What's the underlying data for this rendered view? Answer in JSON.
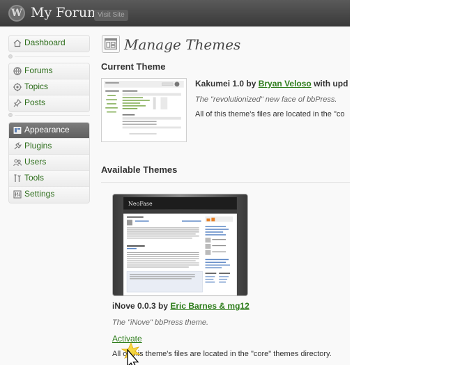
{
  "header": {
    "site_title": "My Forum",
    "visit_site_label": "Visit Site",
    "logo_letter": "W"
  },
  "sidebar": {
    "groups": [
      {
        "items": [
          {
            "label": "Dashboard",
            "icon": "home-icon"
          }
        ]
      },
      {
        "items": [
          {
            "label": "Forums",
            "icon": "globe-icon"
          },
          {
            "label": "Topics",
            "icon": "topics-icon"
          },
          {
            "label": "Posts",
            "icon": "pin-icon"
          }
        ]
      },
      {
        "items": [
          {
            "label": "Appearance",
            "icon": "appearance-icon",
            "current": true
          },
          {
            "label": "Plugins",
            "icon": "plugin-icon"
          },
          {
            "label": "Users",
            "icon": "users-icon"
          },
          {
            "label": "Tools",
            "icon": "tools-icon"
          },
          {
            "label": "Settings",
            "icon": "settings-icon"
          }
        ]
      }
    ]
  },
  "main": {
    "title": "Manage Themes",
    "current_theme": {
      "heading": "Current Theme",
      "name": "Kakumei 1.0 by ",
      "author": "Bryan Veloso",
      "suffix": " with upd",
      "description": "The \"revolutionized\" new face of bbPress.",
      "location": "All of this theme's files are located in the \"co"
    },
    "available_themes": {
      "heading": "Available Themes",
      "items": [
        {
          "name": "iNove 0.0.3 by ",
          "author": "Eric Barnes & mg12",
          "description": "The \"iNove\" bbPress theme.",
          "activate_label": "Activate",
          "location": "All of this theme's files are located in the \"core\" themes directory.",
          "preview_logo": "NeoFase"
        }
      ]
    }
  },
  "colors": {
    "header_bg": "#464646",
    "link_green": "#2e7d1c",
    "current_menu_bg": "#6d6d6d"
  }
}
